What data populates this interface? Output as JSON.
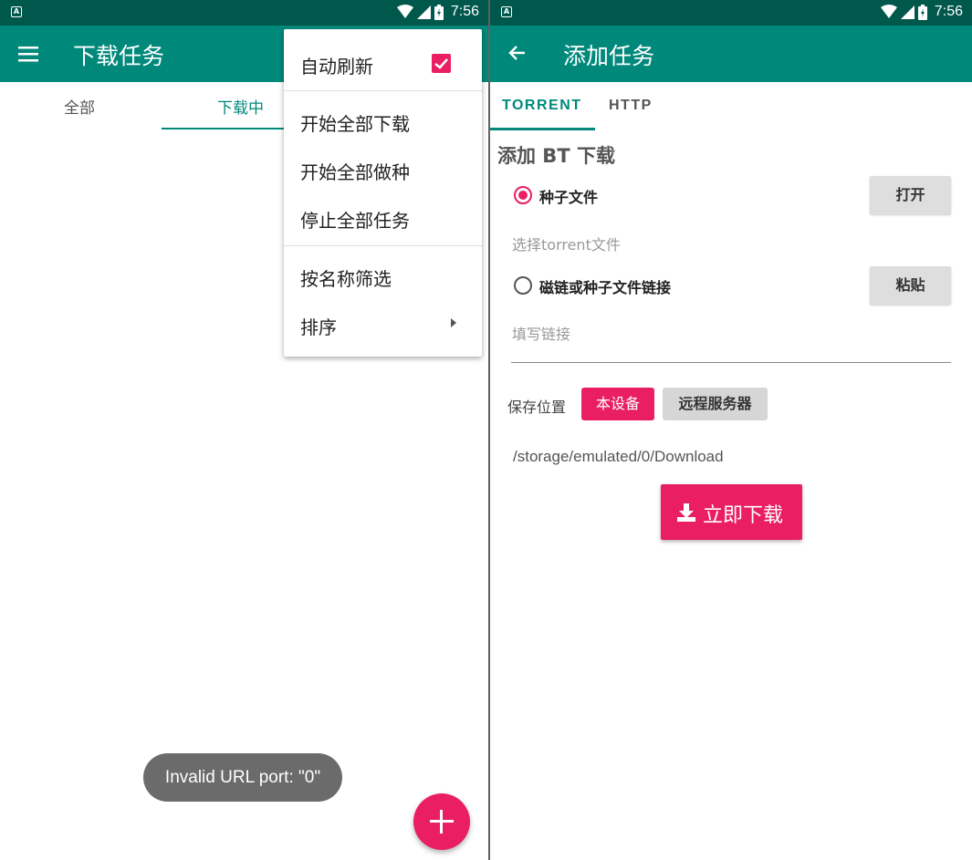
{
  "left": {
    "statusbar": {
      "time": "7:56"
    },
    "appbar": {
      "title": "下载任务"
    },
    "tabs": [
      {
        "label": "全部"
      },
      {
        "label": "下载中"
      }
    ],
    "menu": {
      "items": [
        {
          "label": "自动刷新",
          "checked": true
        },
        {
          "label": "开始全部下载"
        },
        {
          "label": "开始全部做种"
        },
        {
          "label": "停止全部任务"
        },
        {
          "label": "按名称筛选"
        },
        {
          "label": "排序",
          "submenu": true
        }
      ]
    },
    "toast": "Invalid URL port: \"0\"",
    "colors": {
      "primary": "#00897b",
      "primary_dark": "#00574b",
      "accent": "#e91e63"
    }
  },
  "right": {
    "statusbar": {
      "time": "7:56"
    },
    "appbar": {
      "title": "添加任务"
    },
    "tabs": [
      {
        "label": "TORRENT"
      },
      {
        "label": "HTTP"
      }
    ],
    "section_title": "添加 BT 下载",
    "torrent_option": {
      "label": "种子文件",
      "selected": true,
      "button": "打开",
      "hint": "选择torrent文件"
    },
    "magnet_option": {
      "label": "磁链或种子文件链接",
      "selected": false,
      "button": "粘贴",
      "placeholder": "填写链接"
    },
    "save_location": {
      "label": "保存位置",
      "local": "本设备",
      "remote": "远程服务器",
      "path": "/storage/emulated/0/Download"
    },
    "download_button": "立即下载"
  }
}
